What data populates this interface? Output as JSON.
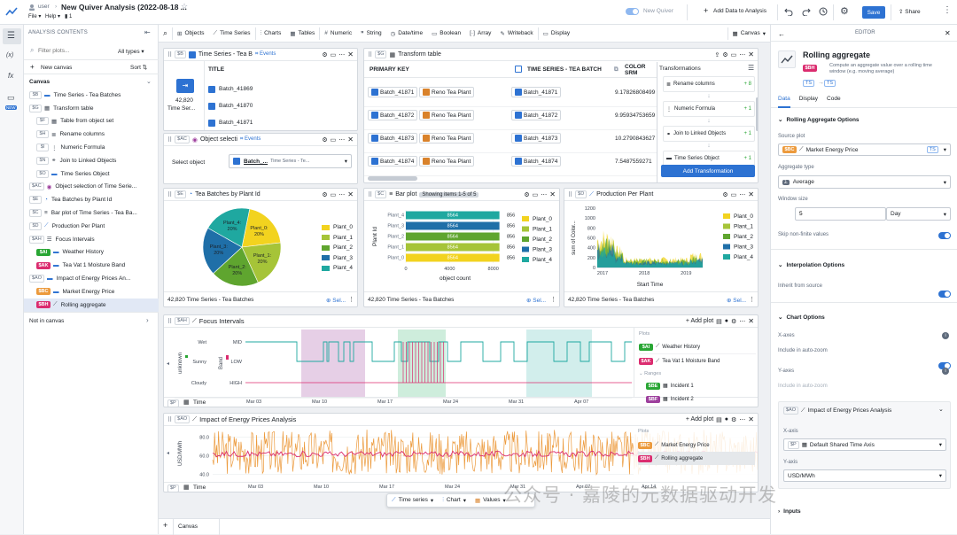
{
  "topbar": {
    "user": "user",
    "title": "New Quiver Analysis (2022-08-18 ...",
    "file": "File",
    "help": "Help",
    "count": "1",
    "new_quiver": "New Quiver",
    "add_data": "Add Data to Analysis",
    "save": "Save",
    "share": "Share"
  },
  "sidebar": {
    "header": "ANALYSIS CONTENTS",
    "filter_placeholder": "Filter plots...",
    "types": "All types",
    "new_canvas": "New canvas",
    "sort": "Sort",
    "canvas_label": "Canvas",
    "not_in_canvas": "Not in canvas",
    "items": [
      {
        "tag": "$B",
        "name": "Time Series - Tea Batches",
        "indent": 0,
        "icon": "timeseries-icon"
      },
      {
        "tag": "$G",
        "name": "Transform table",
        "indent": 0,
        "icon": "table-icon"
      },
      {
        "tag": "$F",
        "name": "Table from object set",
        "indent": 1,
        "icon": "table-icon"
      },
      {
        "tag": "$H",
        "name": "Rename columns",
        "indent": 1,
        "icon": "rename-icon"
      },
      {
        "tag": "$I",
        "name": "Numeric Formula",
        "indent": 1,
        "icon": "formula-icon"
      },
      {
        "tag": "$N",
        "name": "Join to Linked Objects",
        "indent": 1,
        "icon": "link-icon"
      },
      {
        "tag": "$O",
        "name": "Time Series Object",
        "indent": 1,
        "icon": "timeseries-icon"
      },
      {
        "tag": "$AC",
        "name": "Object selection of Time Serie...",
        "indent": 0,
        "icon": "object-icon"
      },
      {
        "tag": "$E",
        "name": "Tea Batches by Plant Id",
        "indent": 0,
        "icon": "pie-icon"
      },
      {
        "tag": "$C",
        "name": "Bar plot of Time Series - Tea Ba...",
        "indent": 0,
        "icon": "bar-icon"
      },
      {
        "tag": "$D",
        "name": "Production Per Plant",
        "indent": 0,
        "icon": "line-icon"
      },
      {
        "tag": "$AH",
        "name": "Focus Intervals",
        "indent": 0,
        "icon": "interval-icon"
      },
      {
        "tag": "$AI",
        "name": "Weather History",
        "indent": 1,
        "chip": "#29a634",
        "icon": "timeseries-icon"
      },
      {
        "tag": "$AK",
        "name": "Tea Vat 1 Moisture Band",
        "indent": 1,
        "chip": "#db2c6f",
        "icon": "timeseries-icon"
      },
      {
        "tag": "$AO",
        "name": "Impact of Energy Prices An...",
        "indent": 0,
        "icon": "timeseries-icon"
      },
      {
        "tag": "$BC",
        "name": "Market Energy Price",
        "indent": 1,
        "chip": "#ec9a3c",
        "icon": "timeseries-icon"
      },
      {
        "tag": "$BH",
        "name": "Rolling aggregate",
        "indent": 1,
        "chip": "#db2c6f",
        "icon": "rolling-icon",
        "active": true
      }
    ]
  },
  "toolbar": {
    "items": [
      "Objects",
      "Time Series",
      "Charts",
      "Tables",
      "Numeric",
      "String",
      "Date/time",
      "Boolean",
      "Array",
      "Writeback",
      "Display"
    ],
    "canvas": "Canvas"
  },
  "panels": {
    "ts_batches": {
      "tag": "$B",
      "title": "Time Series - Tea B",
      "events": "Events",
      "count": "42,820",
      "sub": "Time Ser...",
      "col": "TITLE",
      "rows": [
        "Batch_41869",
        "Batch_41870",
        "Batch_41871"
      ]
    },
    "transform": {
      "tag": "$G",
      "title": "Transform table",
      "cols": [
        "PRIMARY KEY",
        "TIME SERIES - TEA BATCH",
        "COLOR SRM"
      ],
      "rows": [
        {
          "pk": "Batch_41871",
          "plant": "Reno Tea Plant",
          "ts": "Batch_41871",
          "v": "9.17826808499"
        },
        {
          "pk": "Batch_41872",
          "plant": "Reno Tea Plant",
          "ts": "Batch_41872",
          "v": "9.95934753659"
        },
        {
          "pk": "Batch_41873",
          "plant": "Reno Tea Plant",
          "ts": "Batch_41873",
          "v": "10.2790843627"
        },
        {
          "pk": "Batch_41874",
          "plant": "Reno Tea Plant",
          "ts": "Batch_41874",
          "v": "7.5487559271"
        }
      ],
      "transforms_title": "Transformations",
      "steps": [
        {
          "name": "Rename columns",
          "delta": "+ 8"
        },
        {
          "name": "Numeric Formula",
          "delta": "+ 1"
        },
        {
          "name": "Join to Linked Objects",
          "delta": "+ 1"
        },
        {
          "name": "Time Series Object",
          "delta": "+ 1"
        }
      ],
      "add": "Add Transformation"
    },
    "objsel": {
      "tag": "$AC",
      "title": "Object selecti",
      "events": "Events",
      "label": "Select object",
      "value": "Batch_...",
      "source": "Time Series - Te..."
    },
    "pie": {
      "tag": "$E",
      "title": "Tea Batches by Plant Id",
      "footer": "42,820 Time Series - Tea Batches",
      "sel": "Sel..."
    },
    "bar": {
      "tag": "$C",
      "title": "Bar plot",
      "showing": "Showing items 1-5 of 5",
      "footer": "42,820 Time Series - Tea Batches",
      "sel": "Sel..."
    },
    "prod": {
      "tag": "$D",
      "title": "Production Per Plant",
      "footer": "42,820 Time Series - Tea Batches",
      "sel": "Sel..."
    },
    "focus": {
      "tag": "$AH",
      "title": "Focus Intervals",
      "addplot": "Add plot",
      "yleft": "unknown",
      "yleft2": "Band",
      "cats1": [
        "Wet",
        "Sunny",
        "Cloudy"
      ],
      "cats2": [
        "MID",
        "LOW",
        "HIGH"
      ],
      "xaxis": [
        "Mar 03",
        "Mar 10",
        "Mar 17",
        "Mar 24",
        "Mar 31",
        "Apr 07"
      ],
      "sp": "$P",
      "time": "Time",
      "plots_label": "Plots",
      "plots": [
        {
          "tag": "$AI",
          "name": "Weather History",
          "color": "#29a634"
        },
        {
          "tag": "$AK",
          "name": "Tea Vat 1 Moisture Band",
          "color": "#db2c6f"
        }
      ],
      "ranges_label": "Ranges",
      "ranges": [
        {
          "tag": "$BE",
          "name": "Incident 1",
          "color": "#29a634"
        },
        {
          "tag": "$BF",
          "name": "Incident 2",
          "color": "#9d3f9d"
        }
      ]
    },
    "energy": {
      "tag": "$AO",
      "title": "Impact of Energy Prices Analysis",
      "addplot": "Add plot",
      "ylabel": "USD/MWh",
      "yticks": [
        "80.0",
        "60.0",
        "40.0"
      ],
      "xaxis": [
        "Mar 03",
        "Mar 10",
        "Mar 17",
        "Mar 24",
        "Mar 31",
        "Apr 07",
        "Apr 14"
      ],
      "sp": "$P",
      "time": "Time",
      "plots_label": "Plots",
      "plots": [
        {
          "tag": "$BC",
          "name": "Market Energy Price",
          "color": "#ec9a3c"
        },
        {
          "tag": "$BH",
          "name": "Rolling aggregate",
          "color": "#db2c6f"
        }
      ]
    }
  },
  "bottombar": {
    "timeseries": "Time series",
    "chart": "Chart",
    "values": "Values",
    "canvas_tab": "Canvas"
  },
  "editor": {
    "header": "EDITOR",
    "title": "Rolling aggregate",
    "chip": "$BH",
    "desc": "Compute an aggregate value over a rolling time window (e.g. moving average)",
    "pills": [
      "TS",
      "TS"
    ],
    "tabs": [
      "Data",
      "Display",
      "Code"
    ],
    "sec1": "Rolling Aggregate Options",
    "source_label": "Source plot",
    "source_chip": "$BC",
    "source": "Market Energy Price",
    "source_pill": "TS",
    "agg_label": "Aggregate type",
    "agg": "Average",
    "window_label": "Window size",
    "window": "5",
    "window_unit": "Day",
    "skip": "Skip non-finite values",
    "sec2": "Interpolation Options",
    "inherit": "Inherit from source",
    "sec3": "Chart Options",
    "xaxes": "X-axes",
    "incl_auto": "Include in auto-zoom",
    "yaxes": "Y-axes",
    "incl_auto2": "Include in auto-zoom",
    "sub_tag": "$AO",
    "sub_title": "Impact of Energy Prices Analysis",
    "xaxis_label": "X-axis",
    "xaxis_tag": "$P",
    "xaxis_val": "Default Shared Time Axis",
    "yaxis_label": "Y-axis",
    "yaxis_val": "USD/MWh",
    "inputs": "Inputs"
  },
  "watermark": "公众号 · 嘉陵的元数据驱动开发",
  "chart_data": [
    {
      "type": "pie",
      "title": "Tea Batches by Plant Id",
      "slices": [
        {
          "label": "Plant_0",
          "value": 20
        },
        {
          "label": "Plant_1",
          "value": 20
        },
        {
          "label": "Plant_2",
          "value": 20
        },
        {
          "label": "Plant_3",
          "value": 20
        },
        {
          "label": "Plant_4",
          "value": 20
        }
      ],
      "colors": [
        "#f2d31f",
        "#a6c438",
        "#5fa52f",
        "#1f6fa8",
        "#1fa8a0"
      ],
      "legend": "right"
    },
    {
      "type": "bar",
      "orientation": "horizontal",
      "categories": [
        "Plant_4",
        "Plant_3",
        "Plant_2",
        "Plant_1",
        "Plant_0"
      ],
      "values": [
        8564,
        8564,
        8564,
        8564,
        8564
      ],
      "labels": [
        "8564",
        "8564",
        "8564",
        "8564",
        "8564"
      ],
      "end_labels": [
        "856",
        "856",
        "856",
        "856",
        "856"
      ],
      "xlabel": "object count",
      "ylabel": "Plant Id",
      "xticks": [
        "0",
        "4000",
        "8000"
      ],
      "xlim": [
        0,
        9000
      ],
      "colors": [
        "#1fa8a0",
        "#1f6fa8",
        "#5fa52f",
        "#a6c438",
        "#f2d31f"
      ],
      "legend": [
        "Plant_0",
        "Plant_1",
        "Plant_2",
        "Plant_3",
        "Plant_4"
      ]
    },
    {
      "type": "area",
      "title": "Production Per Plant",
      "xlabel": "Start Time",
      "ylabel": "sum of Color...",
      "yticks": [
        "0",
        "200",
        "400",
        "600",
        "800",
        "1000",
        "1200"
      ],
      "ylim": [
        0,
        1200
      ],
      "xticks": [
        "2017",
        "2018",
        "2019"
      ],
      "series": [
        {
          "name": "Plant_0"
        },
        {
          "name": "Plant_1"
        },
        {
          "name": "Plant_2"
        },
        {
          "name": "Plant_3"
        },
        {
          "name": "Plant_4"
        }
      ],
      "colors": [
        "#f2d31f",
        "#a6c438",
        "#5fa52f",
        "#1f6fa8",
        "#1fa8a0"
      ]
    },
    {
      "type": "line",
      "title": "Impact of Energy Prices Analysis",
      "ylabel": "USD/MWh",
      "ylim": [
        35,
        90
      ],
      "series": [
        {
          "name": "Market Energy Price",
          "color": "#ec9a3c"
        },
        {
          "name": "Rolling aggregate",
          "color": "#db2c6f"
        }
      ]
    }
  ]
}
